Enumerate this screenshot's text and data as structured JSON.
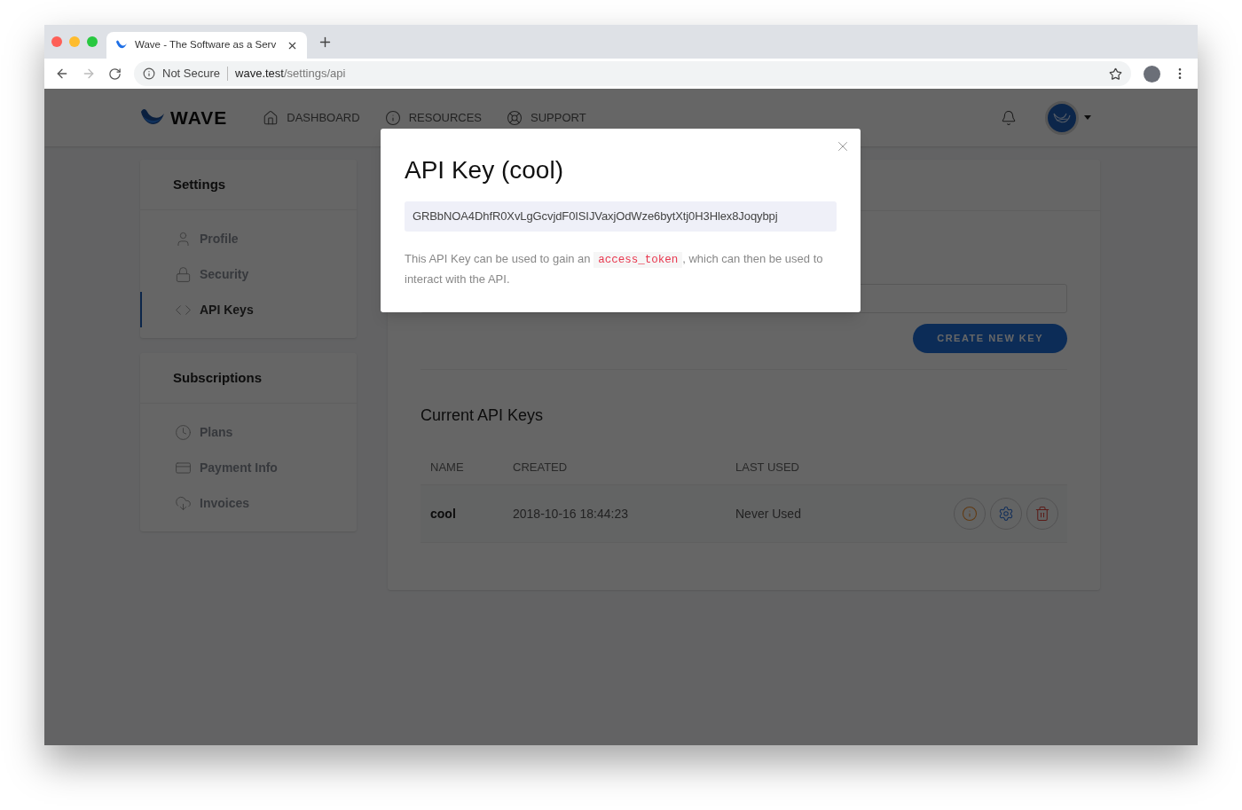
{
  "browser": {
    "tab_title": "Wave - The Software as a Serv",
    "security": "Not Secure",
    "url_host": "wave.test",
    "url_path": "/settings/api"
  },
  "header": {
    "logo": "WAVE",
    "nav": [
      {
        "label": "DASHBOARD"
      },
      {
        "label": "RESOURCES"
      },
      {
        "label": "SUPPORT"
      }
    ]
  },
  "sidebar": [
    {
      "title": "Settings",
      "items": [
        {
          "label": "Profile",
          "selected": false
        },
        {
          "label": "Security",
          "selected": false
        },
        {
          "label": "API Keys",
          "selected": true
        }
      ]
    },
    {
      "title": "Subscriptions",
      "items": [
        {
          "label": "Plans",
          "selected": false
        },
        {
          "label": "Payment Info",
          "selected": false
        },
        {
          "label": "Invoices",
          "selected": false
        }
      ]
    }
  ],
  "main": {
    "create_button": "CREATE NEW KEY",
    "keys_heading": "Current API Keys",
    "table": {
      "columns": [
        "NAME",
        "CREATED",
        "LAST USED"
      ],
      "rows": [
        {
          "name": "cool",
          "created": "2018-10-16 18:44:23",
          "last_used": "Never Used"
        }
      ]
    }
  },
  "modal": {
    "title": "API Key (cool)",
    "key": "GRBbNOA4DhfR0XvLgGcvjdF0ISIJVaxjOdWze6bytXtj0H3Hlex8Joqybpj",
    "description_before": "This API Key can be used to gain an",
    "code": "access_token",
    "description_after": ", which can then be used to interact with the API."
  }
}
